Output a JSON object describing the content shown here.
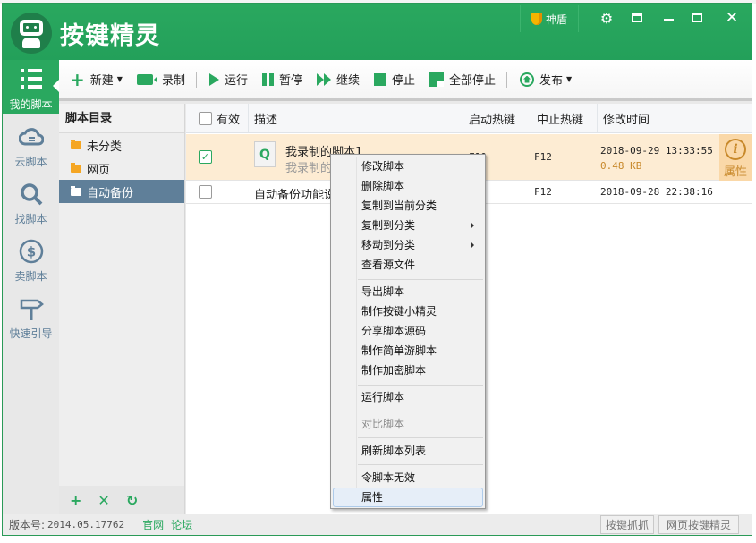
{
  "app": {
    "title": "按键精灵",
    "shield_label": "神盾",
    "controls": [
      "settings",
      "skin",
      "minimize",
      "maximize",
      "close"
    ]
  },
  "nav": [
    {
      "label": "我的脚本",
      "icon": "list-icon",
      "active": true
    },
    {
      "label": "云脚本",
      "icon": "cloud-icon"
    },
    {
      "label": "找脚本",
      "icon": "search-icon"
    },
    {
      "label": "卖脚本",
      "icon": "dollar-icon"
    },
    {
      "label": "快速引导",
      "icon": "signpost-icon"
    }
  ],
  "toolbar": {
    "new": "新建",
    "record": "录制",
    "run": "运行",
    "pause": "暂停",
    "resume": "继续",
    "stop": "停止",
    "stop_all": "全部停止",
    "publish": "发布"
  },
  "categories": {
    "header": "脚本目录",
    "items": [
      {
        "label": "未分类"
      },
      {
        "label": "网页"
      },
      {
        "label": "自动备份",
        "selected": true
      }
    ],
    "footer": {
      "add": "+",
      "delete": "✕",
      "refresh": "↻"
    }
  },
  "table": {
    "columns": [
      "有效",
      "描述",
      "启动热键",
      "中止热键",
      "修改时间"
    ],
    "rows": [
      {
        "enabled": true,
        "title": "我录制的脚本1",
        "subtitle": "我录制的脚本1",
        "start_hotkey": "F10",
        "stop_hotkey": "F12",
        "modified": "2018-09-29 13:33:55",
        "size": "0.48 KB",
        "property_label": "属性"
      },
      {
        "enabled": false,
        "title": "自动备份功能说明",
        "start_hotkey": "",
        "stop_hotkey": "F12",
        "modified": "2018-09-28 22:38:16"
      }
    ]
  },
  "context_menu": {
    "items": [
      {
        "label": "修改脚本"
      },
      {
        "label": "删除脚本"
      },
      {
        "label": "复制到当前分类"
      },
      {
        "label": "复制到分类",
        "submenu": true
      },
      {
        "label": "移动到分类",
        "submenu": true
      },
      {
        "label": "查看源文件"
      },
      {
        "label": "导出脚本"
      },
      {
        "label": "制作按键小精灵"
      },
      {
        "label": "分享脚本源码"
      },
      {
        "label": "制作简单游脚本"
      },
      {
        "label": "制作加密脚本"
      },
      {
        "label": "运行脚本"
      },
      {
        "label": "对比脚本",
        "disabled": true
      },
      {
        "label": "刷新脚本列表"
      },
      {
        "label": "令脚本无效"
      },
      {
        "label": "属性",
        "hover": true
      }
    ]
  },
  "status": {
    "version_label": "版本号:",
    "version": "2014.05.17762",
    "links": [
      "官网",
      "论坛"
    ],
    "buttons": [
      "按键抓抓",
      "网页按键精灵"
    ]
  },
  "colors": {
    "brand_green": "#2aa85f",
    "nav_blue_gray": "#5f7f99",
    "selected_row": "#fdecd3",
    "property_orange": "#c8892b"
  }
}
